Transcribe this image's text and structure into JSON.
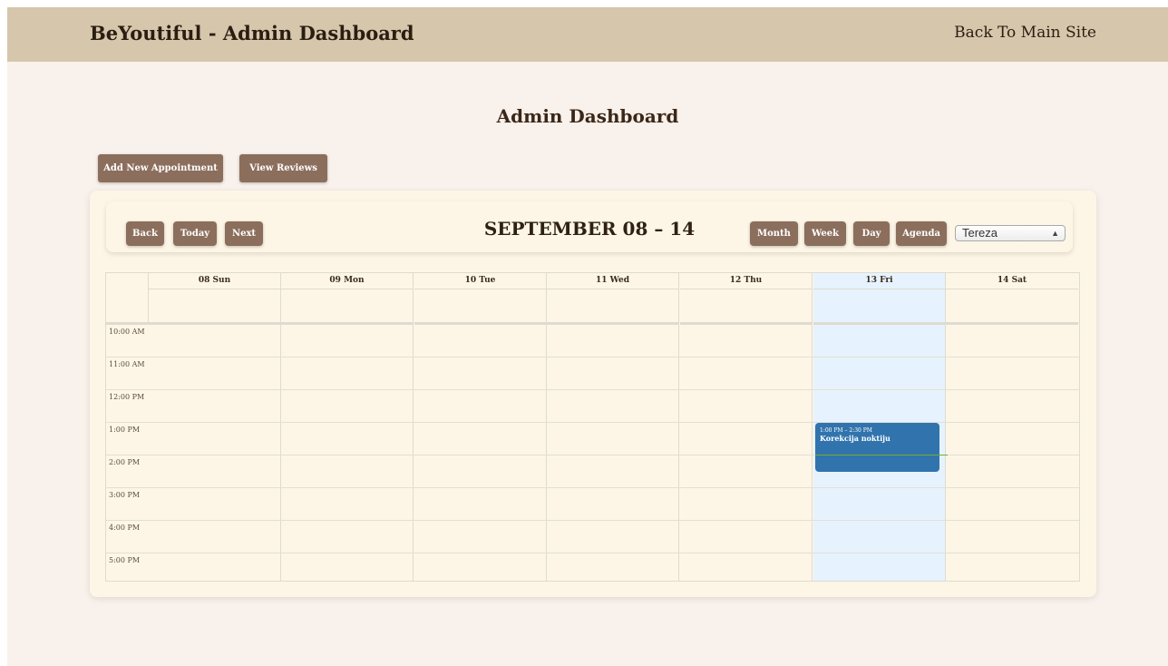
{
  "header": {
    "brand": "BeYoutiful - Admin Dashboard",
    "back_link": "Back To Main Site"
  },
  "page": {
    "title": "Admin Dashboard"
  },
  "actions": {
    "add_appointment": "Add New Appointment",
    "view_reviews": "View Reviews"
  },
  "calendar": {
    "nav": {
      "back": "Back",
      "today": "Today",
      "next": "Next"
    },
    "range_label": "SEPTEMBER 08 – 14",
    "views": {
      "month": "Month",
      "week": "Week",
      "day": "Day",
      "agenda": "Agenda"
    },
    "active_view": "Week",
    "staff_select": {
      "value": "Tereza"
    },
    "days": [
      "08 Sun",
      "09 Mon",
      "10 Tue",
      "11 Wed",
      "12 Thu",
      "13 Fri",
      "14 Sat"
    ],
    "today": "13 Fri",
    "times": [
      "10:00 AM",
      "11:00 AM",
      "12:00 PM",
      "1:00 PM",
      "2:00 PM",
      "3:00 PM",
      "4:00 PM",
      "5:00 PM"
    ],
    "events": [
      {
        "day": "13 Fri",
        "time": "1:00 PM – 2:30 PM",
        "title": "Korekcija noktiju",
        "color": "#3174ad"
      }
    ]
  },
  "colors": {
    "topbar": "#d6c6ab",
    "page_bg": "#f9f1eb",
    "card_bg": "#fdf6e6",
    "button": "#8c6e5d",
    "today_bg": "#e6f3fe",
    "event": "#3174ad",
    "now_indicator": "#74ad31"
  }
}
